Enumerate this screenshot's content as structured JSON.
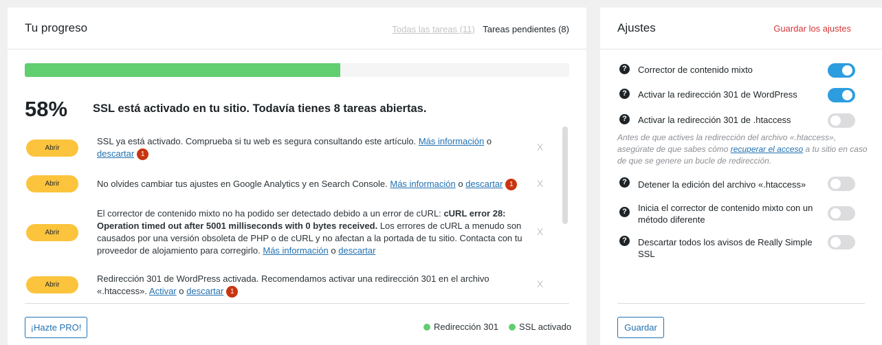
{
  "progress": {
    "title": "Tu progreso",
    "tab_all": "Todas las tareas (11)",
    "tab_pending": "Tareas pendientes (8)",
    "percent_text": "58%",
    "percent_value": 0.58,
    "message": "SSL está activado en tu sitio. Todavía tienes 8 tareas abiertas.",
    "tasks": [
      {
        "button": "Abrir",
        "text": "SSL ya está activado. Comprueba si tu web es segura consultando este artículo.",
        "link": "Más información",
        "sep": "o",
        "dismiss": "descartar",
        "badge": "1",
        "close": "X"
      },
      {
        "button": "Abrir",
        "text": "No olvides cambiar tus ajustes en Google Analytics y en Search Console.",
        "link": "Más información",
        "sep": "o",
        "dismiss": "descartar",
        "badge": "1",
        "close": "X"
      },
      {
        "button": "Abrir",
        "text_a": "El corrector de contenido mixto no ha podido ser detectado debido a un error de cURL:",
        "text_bold": "cURL error 28: Operation timed out after 5001 milliseconds with 0 bytes received.",
        "text_b": "Los errores de cURL a menudo son causados por una versión obsoleta de PHP o de cURL y no afectan a la portada de tu sitio. Contacta con tu proveedor de alojamiento para corregirlo.",
        "link": "Más información",
        "sep": "o",
        "dismiss": "descartar",
        "close": "X"
      },
      {
        "button": "Abrir",
        "text": "Redirección 301 de WordPress activada. Recomendamos activar una redirección 301 en el archivo «.htaccess».",
        "link": "Activar",
        "sep": "o",
        "dismiss": "descartar",
        "badge": "1",
        "close": "X"
      }
    ],
    "pro_button": "¡Hazte PRO!",
    "status_1": "Redirección 301",
    "status_2": "SSL activado",
    "accent": "#61ce70"
  },
  "settings": {
    "title": "Ajustes",
    "save_link": "Guardar los ajustes",
    "items": [
      {
        "label": "Corrector de contenido mixto",
        "enabled": true
      },
      {
        "label": "Activar la redirección 301 de WordPress",
        "enabled": true
      },
      {
        "label": "Activar la redirección 301 de .htaccess",
        "enabled": false
      },
      {
        "label": "Detener la edición del archivo «.htaccess»",
        "enabled": false
      },
      {
        "label": "Inicia el corrector de contenido mixto con un método diferente",
        "enabled": false
      },
      {
        "label": "Descartar todos los avisos de Really Simple SSL",
        "enabled": false
      }
    ],
    "note_a": "Antes de que actives la redirección del archivo «.htaccess», asegúrate de que sabes cómo",
    "note_link": "recuperar el acceso",
    "note_b": "a tu sitio en caso de que se genere un bucle de redirección.",
    "save_button": "Guardar",
    "help_icon": "question-circle-icon",
    "toggle_on_color": "#2c9ddf"
  }
}
